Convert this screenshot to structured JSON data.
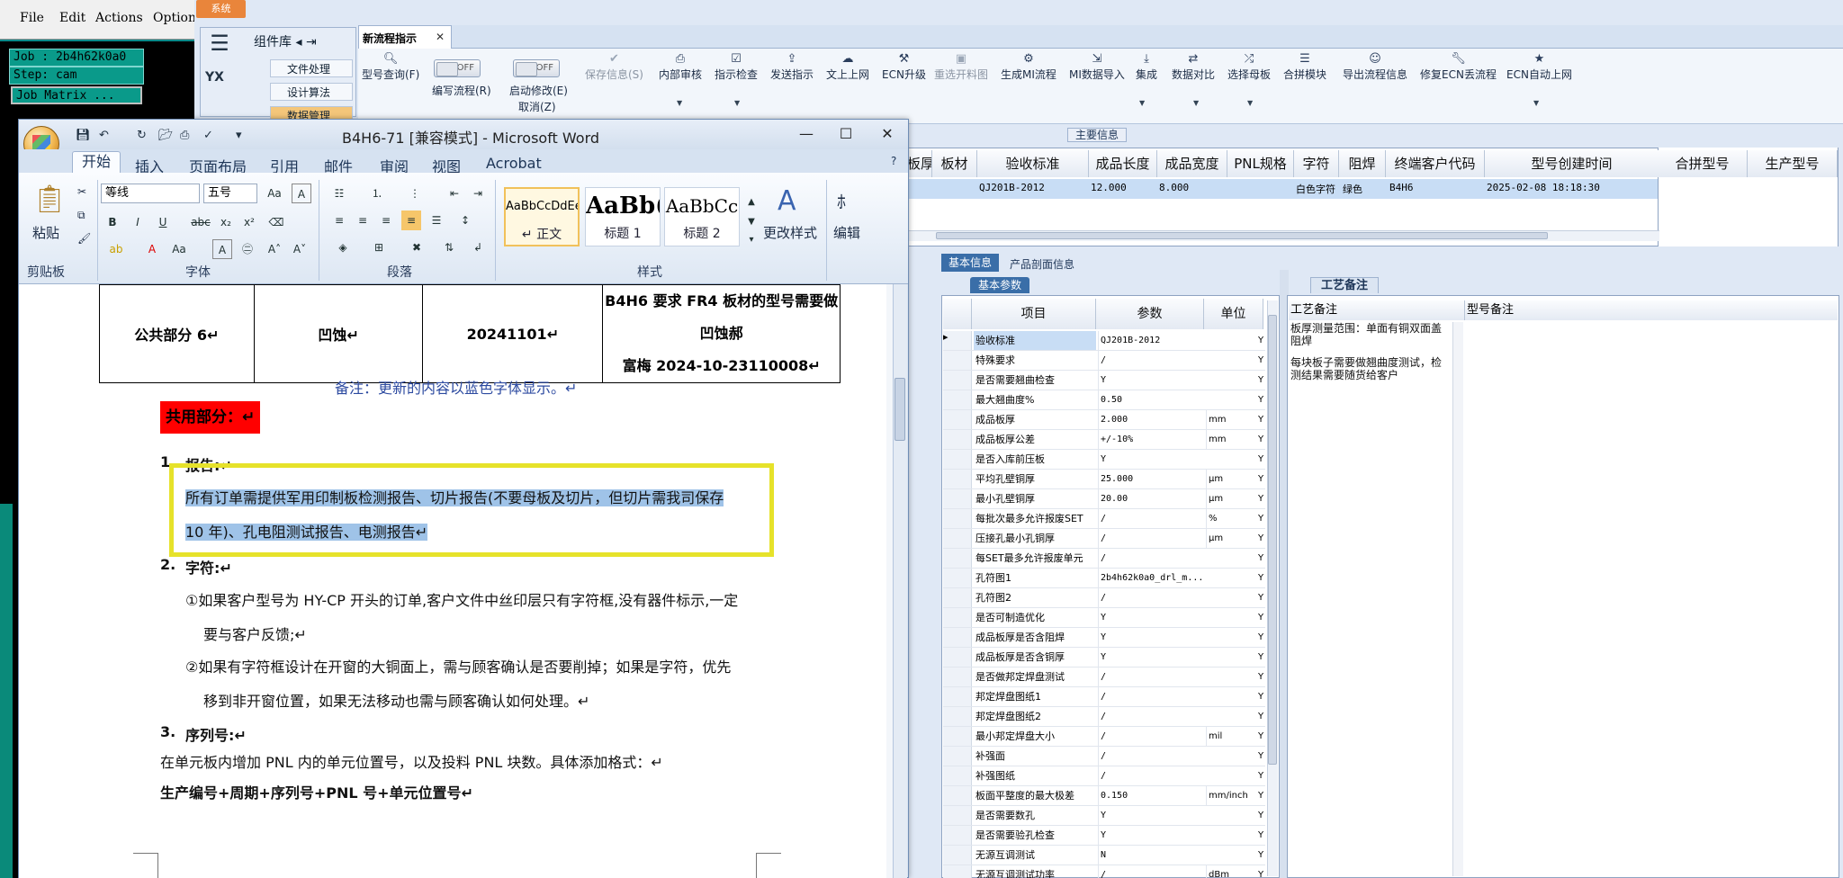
{
  "cam": {
    "menu": [
      "File",
      "Edit",
      "Actions",
      "Option"
    ],
    "job": "Job : 2b4h62k0a0",
    "step": "Step: cam",
    "job_matrix": "Job Matrix ..."
  },
  "erp": {
    "system_tab": "系统",
    "sidebar": {
      "title": "组件库",
      "yx_label": "YX",
      "items": [
        "文件处理",
        "设计算法",
        "数据管理"
      ]
    },
    "active_tab": "新流程指示",
    "toolbar": {
      "model_query": "型号查询(F)",
      "edit_flow": "编写流程(R)",
      "start_modify": "启动修改(E)",
      "cancel": "取消(Z)",
      "toggle_off": "OFF",
      "save_info": "保存信息(S)",
      "internal_review": "内部审核",
      "indication_check": "指示检查",
      "send_indication": "发送指示",
      "file_upload": "文上上网",
      "ecn_upgrade": "ECN升级",
      "reselect_drawing": "重选开料图",
      "gen_mi_flow": "生成MI流程",
      "mi_data_import": "MI数据导入",
      "integrate": "集成",
      "data_compare": "数据对比",
      "select_master": "选择母板",
      "merge_module": "合拼模块",
      "export_flow_info": "导出流程信息",
      "repair_ecn_flow": "修复ECN丢流程",
      "ecn_auto_upload": "ECN自动上网"
    },
    "main_info_label": "主要信息",
    "grid": {
      "headers": [
        "板厚",
        "板材",
        "验收标准",
        "成品长度",
        "成品宽度",
        "PNL规格",
        "字符",
        "阻焊",
        "终端客户代码",
        "型号创建时间"
      ],
      "row": [
        "",
        "",
        "QJ201B-2012",
        "12.000",
        "8.000",
        "",
        "白色字符",
        "绿色",
        "B4H6",
        "2025-02-08 18:18:30"
      ],
      "right_headers": [
        "合拼型号",
        "生产型号"
      ]
    },
    "bottom_tabs": [
      "基本信息",
      "产品剖面信息"
    ],
    "params": {
      "tab": "基本参数",
      "headers": [
        "项目",
        "参数",
        "单位"
      ],
      "rows": [
        [
          "验收标准",
          "QJ201B-2012",
          "",
          "Y"
        ],
        [
          "特殊要求",
          "/",
          "",
          "Y"
        ],
        [
          "是否需要翘曲检查",
          "Y",
          "",
          "Y"
        ],
        [
          "最大翘曲度%",
          "0.50",
          "",
          "Y"
        ],
        [
          "成品板厚",
          "2.000",
          "mm",
          "Y"
        ],
        [
          "成品板厚公差",
          "+/-10%",
          "mm",
          "Y"
        ],
        [
          "是否入库前压板",
          "Y",
          "",
          "Y"
        ],
        [
          "平均孔壁铜厚",
          "25.000",
          "μm",
          "Y"
        ],
        [
          "最小孔壁铜厚",
          "20.00",
          "μm",
          "Y"
        ],
        [
          "每批次最多允许报废SET",
          "/",
          "%",
          "Y"
        ],
        [
          "压接孔最小孔铜厚",
          "/",
          "μm",
          "Y"
        ],
        [
          "每SET最多允许报废单元",
          "/",
          "",
          "Y"
        ],
        [
          "孔符图1",
          "2b4h62k0a0_drl_m...",
          "",
          "Y"
        ],
        [
          "孔符图2",
          "/",
          "",
          "Y"
        ],
        [
          "是否可制造优化",
          "Y",
          "",
          "Y"
        ],
        [
          "成品板厚是否含阻焊",
          "Y",
          "",
          "Y"
        ],
        [
          "成品板厚是否含铜厚",
          "Y",
          "",
          "Y"
        ],
        [
          "是否做邦定焊盘测试",
          "/",
          "",
          "Y"
        ],
        [
          "邦定焊盘图纸1",
          "/",
          "",
          "Y"
        ],
        [
          "邦定焊盘图纸2",
          "/",
          "",
          "Y"
        ],
        [
          "最小邦定焊盘大小",
          "/",
          "mil",
          "Y"
        ],
        [
          "补强面",
          "/",
          "",
          "Y"
        ],
        [
          "补强图纸",
          "/",
          "",
          "Y"
        ],
        [
          "板面平整度的最大极差",
          "0.150",
          "mm/inch",
          "Y"
        ],
        [
          "是否需要数孔",
          "Y",
          "",
          "Y"
        ],
        [
          "是否需要验孔检查",
          "Y",
          "",
          "Y"
        ],
        [
          "无源互调测试",
          "N",
          "",
          "Y"
        ],
        [
          "无源互调测试功率",
          "/",
          "dBm",
          "Y"
        ]
      ]
    },
    "craft": {
      "tab": "工艺备注",
      "col1": "工艺备注",
      "col2": "型号备注",
      "note1": "板厚测量范围：单面有铜双面盖阻焊",
      "note2": "每块板子需要做翘曲度测试，检测结果需要随货给客户"
    }
  },
  "word": {
    "title": "B4H6-71 [兼容模式] - Microsoft Word",
    "tabs": [
      "开始",
      "插入",
      "页面布局",
      "引用",
      "邮件",
      "审阅",
      "视图",
      "Acrobat"
    ],
    "clipboard": {
      "paste": "粘贴",
      "label": "剪贴板"
    },
    "font": {
      "name": "等线",
      "size": "五号",
      "label": "字体"
    },
    "paragraph_label": "段落",
    "styles": {
      "label": "样式",
      "items": [
        {
          "sample": "AaBbCcDdEe",
          "name": "↵ 正文"
        },
        {
          "sample": "AaBb(",
          "name": "标题 1"
        },
        {
          "sample": "AaBbCc",
          "name": "标题 2"
        }
      ],
      "change": "更改样式"
    },
    "edit_label": "编辑",
    "doc": {
      "table_row": [
        "公共部分 6↵",
        "凹蚀↵",
        "20241101↵"
      ],
      "table_row_note1": "B4H6 要求 FR4 板材的型号需要做凹蚀郝",
      "table_row_note2": "富梅 2024-10-23110008↵",
      "note": "备注：更新的内容以蓝色字体显示。↵",
      "shared_heading": "共用部分：↵",
      "s1_num": "1.",
      "s1_title": "报告:↵",
      "s1_line1": "所有订单需提供军用印制板检测报告、切片报告(不要母板及切片，但切片需我司保存",
      "s1_line2": "10 年)、孔电阻测试报告、电测报告↵",
      "s2_num": "2.",
      "s2_title": "字符:↵",
      "s2_a1": "①如果客户型号为 HY-CP 开头的订单,客户文件中丝印层只有字符框,没有器件标示,一定",
      "s2_a2": "要与客户反馈;↵",
      "s2_b1": "②如果有字符框设计在开窗的大铜面上，需与顾客确认是否要削掉；如果是字符，优先",
      "s2_b2": "移到非开窗位置，如果无法移动也需与顾客确认如何处理。↵",
      "s3_num": "3.",
      "s3_title": "序列号:↵",
      "s3_line": "在单元板内增加 PNL 内的单元位置号，以及投料 PNL 块数。具体添加格式：↵",
      "s3_format": "生产编号+周期+序列号+PNL 号+单元位置号↵"
    }
  }
}
